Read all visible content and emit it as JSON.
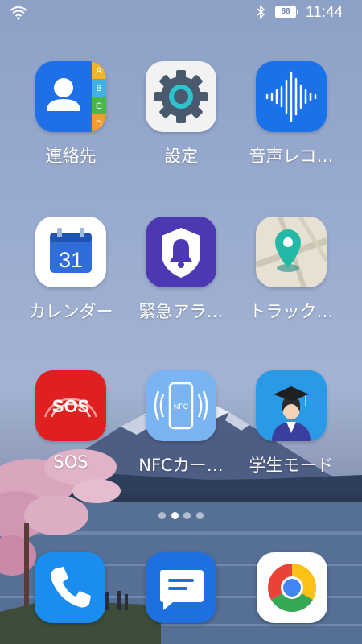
{
  "status_bar": {
    "battery_level": "88",
    "time": "11:44",
    "icons": [
      "wifi-icon",
      "bluetooth-icon",
      "battery-icon"
    ]
  },
  "apps": [
    {
      "label": "連絡先",
      "icon": "contacts-icon",
      "tab_letters": [
        "A",
        "B",
        "C",
        "D"
      ]
    },
    {
      "label": "設定",
      "icon": "settings-gear-icon"
    },
    {
      "label": "音声レコ…",
      "icon": "voice-recorder-icon"
    },
    {
      "label": "カレンダー",
      "icon": "calendar-icon",
      "day": "31"
    },
    {
      "label": "緊急アラ…",
      "icon": "emergency-alert-bell-icon"
    },
    {
      "label": "トラック…",
      "icon": "map-pin-tracking-icon"
    },
    {
      "label": "SOS",
      "icon": "sos-icon",
      "icon_text": "SOS"
    },
    {
      "label": "NFCカー…",
      "icon": "nfc-card-icon",
      "icon_text": "NFC"
    },
    {
      "label": "学生モード",
      "icon": "student-mode-graduate-icon"
    }
  ],
  "page_indicator": {
    "count": 4,
    "active": 1
  },
  "dock": [
    {
      "name": "phone",
      "icon": "phone-icon"
    },
    {
      "name": "messages",
      "icon": "messages-icon"
    },
    {
      "name": "chrome",
      "icon": "chrome-icon"
    }
  ],
  "colors": {
    "contacts_blue": "#1e6fe8",
    "settings_bg": "#f2f2f2",
    "recorder_blue": "#1a72e8",
    "calendar_blue": "#2f6ed8",
    "alert_purple": "#4d38b4",
    "sos_red": "#e02020",
    "nfc_blue": "#7ab4f2",
    "student_blue": "#2a9ae6",
    "phone_blue": "#1b8cf0",
    "messages_blue": "#1e6fe0"
  }
}
